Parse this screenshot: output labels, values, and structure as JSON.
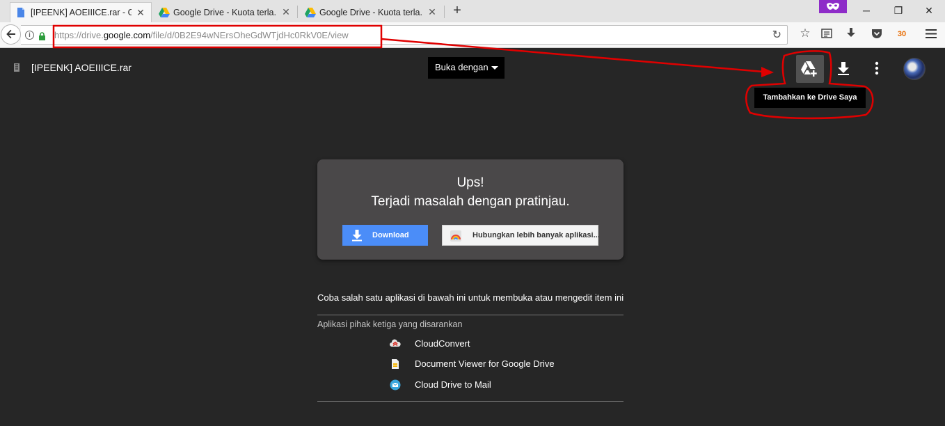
{
  "browser": {
    "tabs": [
      {
        "title": "[IPEENK] AOEIIICE.rar - Go...",
        "icon": "document-icon"
      },
      {
        "title": "Google Drive - Kuota terla...",
        "icon": "google-drive-icon"
      },
      {
        "title": "Google Drive - Kuota terla...",
        "icon": "google-drive-icon"
      }
    ],
    "url_prefix": "https://drive.",
    "url_domain": "google.com",
    "url_path": "/file/d/0B2E94wNErsOheGdWTjdHc0RkV0E/view",
    "extension_badge": "30"
  },
  "drive": {
    "file_title": "[IPEENK] AOEIIICE.rar",
    "open_with": "Buka dengan",
    "tooltip": "Tambahkan ke Drive Saya"
  },
  "error_card": {
    "title": "Ups!",
    "message": "Terjadi masalah dengan pratinjau.",
    "download_label": "Download",
    "connect_label": "Hubungkan lebih banyak aplikasi..."
  },
  "suggestions": {
    "prompt": "Coba salah satu aplikasi di bawah ini untuk membuka atau mengedit item ini",
    "heading": "Aplikasi pihak ketiga yang disarankan",
    "apps": [
      {
        "name": "CloudConvert",
        "icon": "cloudconvert-icon"
      },
      {
        "name": "Document Viewer for Google Drive",
        "icon": "document-viewer-icon"
      },
      {
        "name": "Cloud Drive to Mail",
        "icon": "mail-icon"
      }
    ]
  },
  "colors": {
    "background": "#262626",
    "card": "#4a4849",
    "accent_blue": "#4b8df8",
    "annotation_red": "#e00000",
    "private_mask": "#8e2cc8"
  }
}
